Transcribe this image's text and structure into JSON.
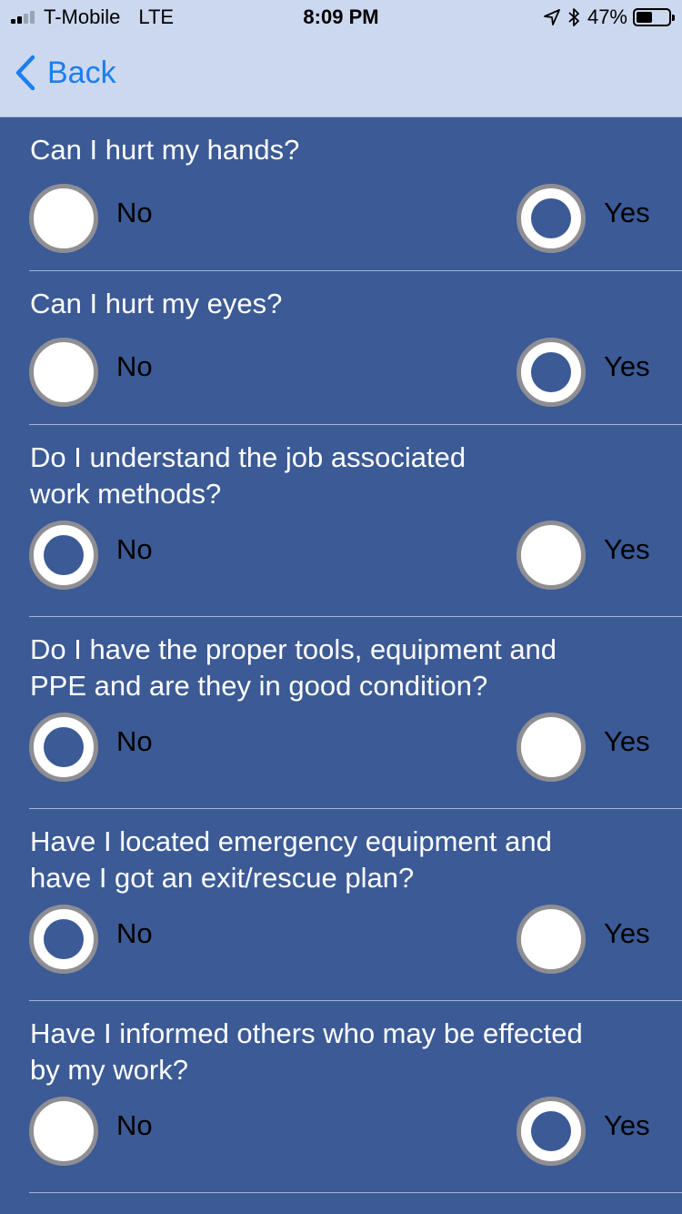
{
  "status_bar": {
    "carrier": "T-Mobile",
    "network": "LTE",
    "time": "8:09 PM",
    "battery": "47%",
    "battery_level": 0.47,
    "icons": [
      "signal-icon",
      "location-icon",
      "bluetooth-icon",
      "battery-icon"
    ]
  },
  "nav": {
    "back_label": "Back",
    "back_icon": "chevron-left-icon"
  },
  "colors": {
    "background": "#3b5a96",
    "header": "#ccd8ee",
    "accent": "#1a7ef0"
  },
  "questions": [
    {
      "text": "Can I hurt my hands?",
      "no_label": "No",
      "yes_label": "Yes",
      "selected": "yes"
    },
    {
      "text": "Can I hurt my eyes?",
      "no_label": "No",
      "yes_label": "Yes",
      "selected": "yes"
    },
    {
      "text": "Do I understand the job associated\nwork methods?",
      "no_label": "No",
      "yes_label": "Yes",
      "selected": "no"
    },
    {
      "text": "Do I have the proper tools, equipment and\nPPE and are they in good condition?",
      "no_label": "No",
      "yes_label": "Yes",
      "selected": "no"
    },
    {
      "text": "Have I located emergency equipment and\nhave I got an exit/rescue plan?",
      "no_label": "No",
      "yes_label": "Yes",
      "selected": "no"
    },
    {
      "text": "Have I informed others who may be effected\nby my work?",
      "no_label": "No",
      "yes_label": "Yes",
      "selected": "yes"
    }
  ]
}
